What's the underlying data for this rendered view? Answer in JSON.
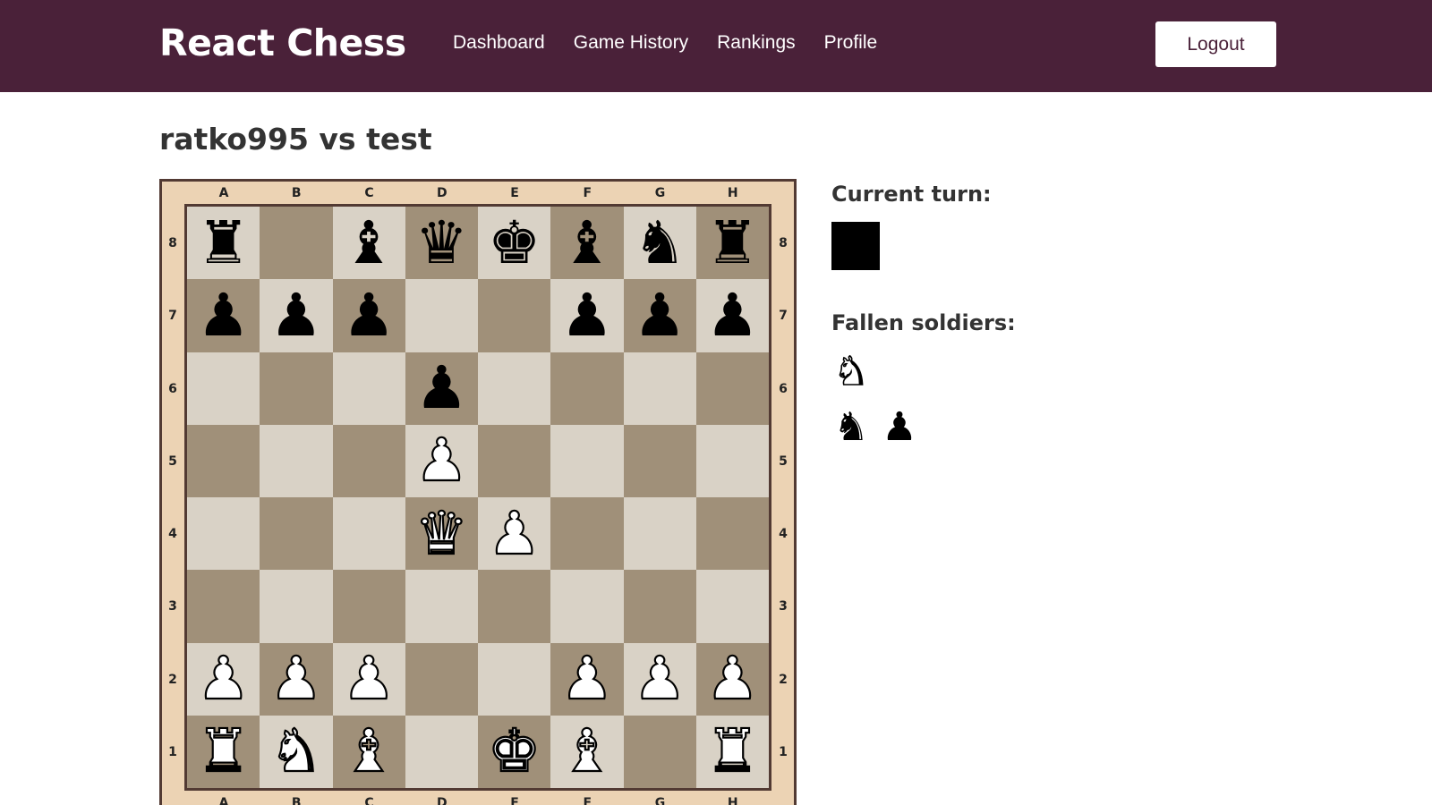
{
  "app": {
    "brand": "React Chess",
    "nav": [
      "Dashboard",
      "Game History",
      "Rankings",
      "Profile"
    ],
    "logout_label": "Logout",
    "colors": {
      "navbar": "#4a2139",
      "light_square": "#d9d2c6",
      "dark_square": "#a09079",
      "board_frame": "#ecd3b4"
    }
  },
  "game": {
    "title": "ratko995 vs test",
    "files": [
      "A",
      "B",
      "C",
      "D",
      "E",
      "F",
      "G",
      "H"
    ],
    "ranks": [
      "8",
      "7",
      "6",
      "5",
      "4",
      "3",
      "2",
      "1"
    ],
    "board": [
      [
        "b-rook",
        "",
        "b-bishop",
        "b-queen",
        "b-king",
        "b-bishop",
        "b-knight",
        "b-rook"
      ],
      [
        "b-pawn",
        "b-pawn",
        "b-pawn",
        "",
        "",
        "b-pawn",
        "b-pawn",
        "b-pawn"
      ],
      [
        "",
        "",
        "",
        "b-pawn",
        "",
        "",
        "",
        ""
      ],
      [
        "",
        "",
        "",
        "w-pawn",
        "",
        "",
        "",
        ""
      ],
      [
        "",
        "",
        "",
        "w-queen",
        "w-pawn",
        "",
        "",
        ""
      ],
      [
        "",
        "",
        "",
        "",
        "",
        "",
        "",
        ""
      ],
      [
        "w-pawn",
        "w-pawn",
        "w-pawn",
        "",
        "",
        "w-pawn",
        "w-pawn",
        "w-pawn"
      ],
      [
        "w-rook",
        "w-knight",
        "w-bishop",
        "",
        "w-king",
        "w-bishop",
        "",
        "w-rook"
      ]
    ]
  },
  "sidebar": {
    "current_turn_label": "Current turn:",
    "current_turn_color": "black",
    "fallen_label": "Fallen soldiers:",
    "fallen_white": [
      "w-knight"
    ],
    "fallen_black": [
      "b-knight",
      "b-pawn"
    ]
  }
}
